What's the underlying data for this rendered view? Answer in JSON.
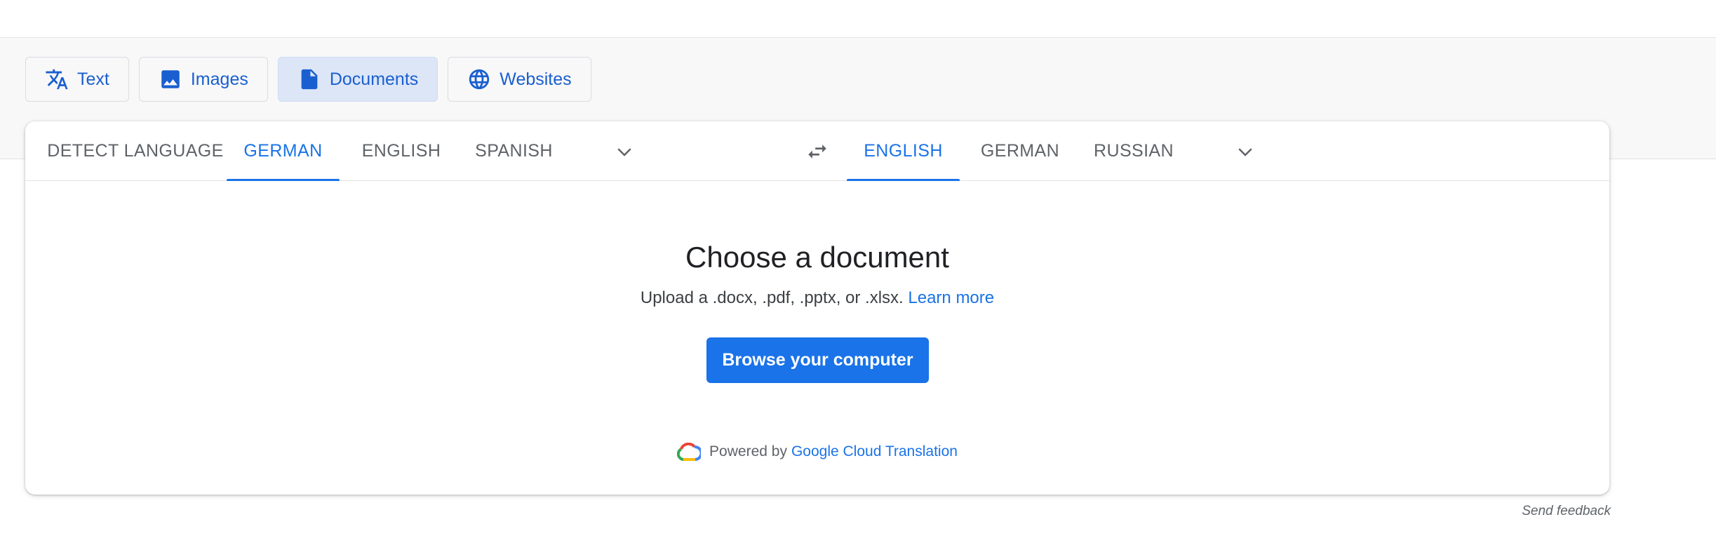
{
  "mode_tabs": [
    {
      "label": "Text",
      "icon": "translate-icon",
      "active": false
    },
    {
      "label": "Images",
      "icon": "image-icon",
      "active": false
    },
    {
      "label": "Documents",
      "icon": "document-icon",
      "active": true
    },
    {
      "label": "Websites",
      "icon": "globe-icon",
      "active": false
    }
  ],
  "source_langs": [
    {
      "label": "DETECT LANGUAGE",
      "active": false
    },
    {
      "label": "GERMAN",
      "active": true
    },
    {
      "label": "ENGLISH",
      "active": false
    },
    {
      "label": "SPANISH",
      "active": false
    }
  ],
  "target_langs": [
    {
      "label": "ENGLISH",
      "active": true
    },
    {
      "label": "GERMAN",
      "active": false
    },
    {
      "label": "RUSSIAN",
      "active": false
    }
  ],
  "content": {
    "title": "Choose a document",
    "subtitle": "Upload a .docx, .pdf, .pptx, or .xlsx.",
    "learn_more": "Learn more",
    "browse_label": "Browse your computer"
  },
  "powered": {
    "prefix": "Powered by",
    "link": "Google Cloud Translation"
  },
  "feedback": "Send feedback",
  "colors": {
    "accent": "#1a73e8",
    "tab_active_bg": "#dce6f7"
  }
}
